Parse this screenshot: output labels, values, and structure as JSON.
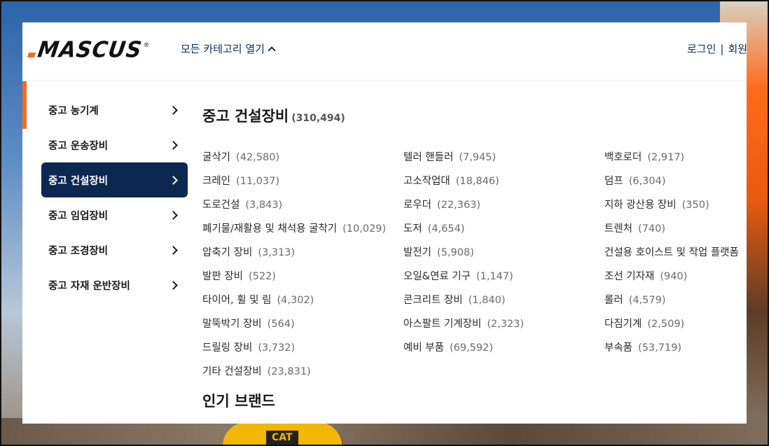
{
  "header": {
    "logo_text": "MASCUS",
    "logo_reg": "®",
    "category_toggle": "모든 카테고리 열기",
    "login": "로그인",
    "separator": "|",
    "register": "회원"
  },
  "sidebar": {
    "items": [
      {
        "label": "중고 농기계"
      },
      {
        "label": "중고 운송장비"
      },
      {
        "label": "중고 건설장비"
      },
      {
        "label": "중고 임업장비"
      },
      {
        "label": "중고 조경장비"
      },
      {
        "label": "중고 자재 운반장비"
      }
    ]
  },
  "main": {
    "title": "중고 건설장비",
    "title_count": "(310,494)",
    "columns": [
      [
        {
          "name": "굴삭기",
          "count": "(42,580)"
        },
        {
          "name": "크레인",
          "count": "(11,037)"
        },
        {
          "name": "도로건설",
          "count": "(3,843)"
        },
        {
          "name": "폐기물/재활용 및 채석용 굴착기",
          "count": "(10,029)"
        },
        {
          "name": "압축기 장비",
          "count": "(3,313)"
        },
        {
          "name": "발판 장비",
          "count": "(522)"
        },
        {
          "name": "타이어, 휠 및 림",
          "count": "(4,302)"
        },
        {
          "name": "말뚝박기 장비",
          "count": "(564)"
        },
        {
          "name": "드릴링 장비",
          "count": "(3,732)"
        },
        {
          "name": "기타 건설장비",
          "count": "(23,831)"
        }
      ],
      [
        {
          "name": "텔러 핸들러",
          "count": "(7,945)"
        },
        {
          "name": "고소작업대",
          "count": "(18,846)"
        },
        {
          "name": "로우더",
          "count": "(22,363)"
        },
        {
          "name": "도저",
          "count": "(4,654)"
        },
        {
          "name": "발전기",
          "count": "(5,908)"
        },
        {
          "name": "오일&연료 기구",
          "count": "(1,147)"
        },
        {
          "name": "콘크리트 장비",
          "count": "(1,840)"
        },
        {
          "name": "아스팔트 기계장비",
          "count": "(2,323)"
        },
        {
          "name": "예비 부품",
          "count": "(69,592)"
        }
      ],
      [
        {
          "name": "백호로더",
          "count": "(2,917)"
        },
        {
          "name": "덤프",
          "count": "(6,304)"
        },
        {
          "name": "지하 광산용 장비",
          "count": "(350)"
        },
        {
          "name": "트렌처",
          "count": "(740)"
        },
        {
          "name": "건설용 호이스트 및 작업 플랫폼",
          "count": ""
        },
        {
          "name": "조선 기자재",
          "count": "(940)"
        },
        {
          "name": "롤러",
          "count": "(4,579)"
        },
        {
          "name": "다짐기계",
          "count": "(2,509)"
        },
        {
          "name": "부속품",
          "count": "(53,719)"
        }
      ]
    ],
    "brands_title": "인기 브랜드"
  },
  "background": {
    "cat_text": "CAT"
  },
  "colors": {
    "brand_orange": "#f26c22",
    "navy": "#0c2850",
    "link_navy": "#0c2d53"
  }
}
